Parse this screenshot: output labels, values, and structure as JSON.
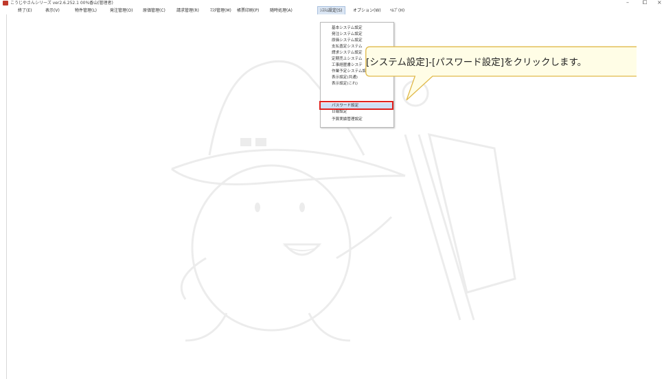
{
  "window": {
    "title": "こうじやさんシリーズ ver2.6.252.1 00%香山(管理者)",
    "controls": {
      "minimize": "–",
      "maximize": "⧠",
      "close": "×"
    }
  },
  "menu": [
    {
      "label": "終了(E)"
    },
    {
      "label": "表示(V)"
    },
    {
      "label": "物件管理(L)"
    },
    {
      "label": "発注管理(O)"
    },
    {
      "label": "原価管理(C)"
    },
    {
      "label": "請求管理(R)"
    },
    {
      "label": "ﾏｽﾀ管理(M)"
    },
    {
      "label": "帳票印刷(P)"
    },
    {
      "label": "随時処理(A)"
    },
    {
      "label": "ｼｽﾃﾑ設定(S)"
    },
    {
      "label": "オプション(W)"
    },
    {
      "label": "ﾍﾙﾌﾟ(H)"
    }
  ],
  "dropdown": {
    "items": [
      {
        "label": "基本システム設定"
      },
      {
        "label": "発注システム設定"
      },
      {
        "label": "原価システム設定"
      },
      {
        "label": "支払査定システム"
      },
      {
        "label": "請求システム設定"
      },
      {
        "label": "定期売上システム"
      },
      {
        "label": "工事経歴書システ"
      },
      {
        "label": "作業予定システム設定",
        "submenu": "▸"
      },
      {
        "label": "表示設定(共通)"
      },
      {
        "label": "表示設定(これ)"
      },
      {
        "label": "パスワード設定"
      },
      {
        "label": "日報設定"
      },
      {
        "label": "予算実績管理設定"
      }
    ],
    "selected_index": 10
  },
  "callout": {
    "text": "[システム設定]-[パスワード設定]をクリックします。",
    "fill": "#fffde6",
    "border": "#e0b94a"
  },
  "colors": {
    "highlight_border": "#e0201c",
    "selected_bg": "#cfe0f5",
    "active_menu_bg": "#dbe6f4"
  }
}
